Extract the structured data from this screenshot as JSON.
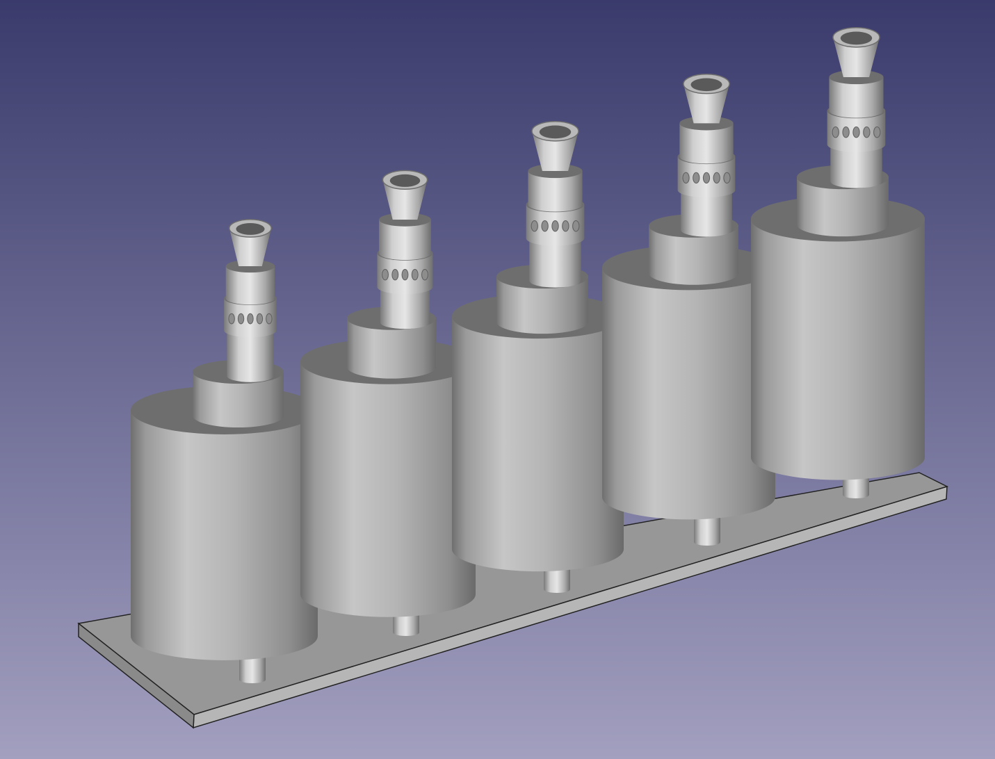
{
  "viewport": {
    "background_top": "#3a3b6c",
    "background_bottom": "#a29fbf"
  },
  "model": {
    "base_plate": {
      "top_face": "#979797",
      "front_face": "#b6b6b6",
      "edge_color": "#222222"
    },
    "assemblies": [
      {
        "id": 1
      },
      {
        "id": 2
      },
      {
        "id": 3
      },
      {
        "id": 4
      },
      {
        "id": 5
      }
    ],
    "shade": {
      "light": "#c9c9c9",
      "mid": "#a8a8a8",
      "dark": "#7c7c7c",
      "top": "#6e6e6e",
      "hole": "#5a5a5a"
    }
  }
}
